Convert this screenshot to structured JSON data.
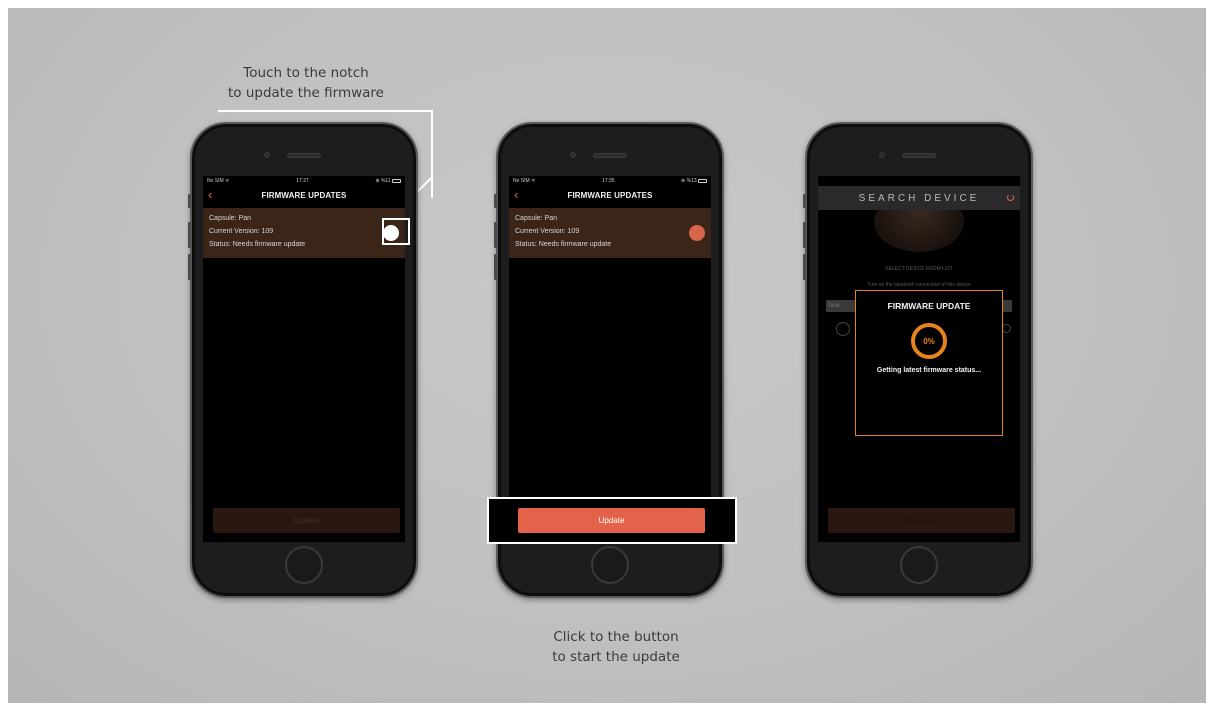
{
  "captions": {
    "top": [
      "Touch to the notch",
      "to update the firmware"
    ],
    "bottom": [
      "Click to the button",
      "to start the update"
    ]
  },
  "phone1": {
    "status": {
      "carrier": "No SIM ᯤ",
      "time": "17:27",
      "battery": "⊕ %11"
    },
    "nav": {
      "back_icon": "‹",
      "title": "FIRMWARE UPDATES"
    },
    "device": {
      "capsule": "Capsule: Pan",
      "version": "Current Version: 109",
      "status": "Status: Needs firmware update"
    },
    "update_label": "Update"
  },
  "phone2": {
    "status": {
      "carrier": "No SIM ᯤ",
      "time": "17:35",
      "battery": "⊕ %13"
    },
    "nav": {
      "back_icon": "‹",
      "title": "FIRMWARE UPDATES"
    },
    "device": {
      "capsule": "Capsule: Pan",
      "version": "Current Version: 109",
      "status": "Status: Needs firmware update"
    },
    "update_label": "Update"
  },
  "phone3": {
    "header_title": "SEARCH DEVICE",
    "select_text": "SELECT DEVICE FROM LIST",
    "bluetooth_text": "Turn on the bluetooth connection of this device",
    "avail_text": "Avai",
    "modal": {
      "title": "FIRMWARE UPDATE",
      "progress": "0%",
      "status": "Getting latest firmware status..."
    },
    "footer_label": "Connect"
  },
  "colors": {
    "accent": "#e2634a",
    "progress": "#e8841c",
    "card": "#3a2518"
  }
}
